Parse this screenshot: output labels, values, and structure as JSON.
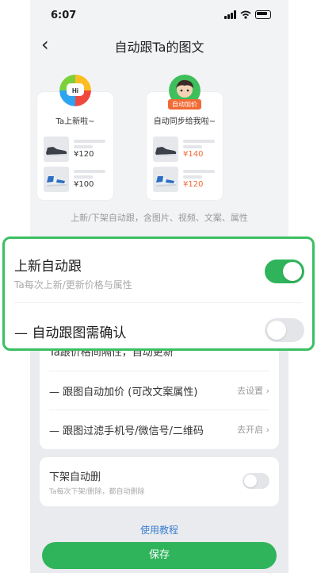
{
  "statusbar": {
    "time": "6:07"
  },
  "header": {
    "title": "自动跟Ta的图文",
    "back_label": "‹"
  },
  "preview": {
    "left_card": {
      "title": "Ta上新啦~",
      "items": [
        {
          "price": "¥120"
        },
        {
          "price": "¥100"
        }
      ]
    },
    "right_card": {
      "title": "自动同步给我啦~",
      "badge": "自动加价",
      "items": [
        {
          "price": "¥140"
        },
        {
          "price": "¥120"
        }
      ]
    },
    "caption": "上新/下架自动跟，含图片、视频、文案、属性"
  },
  "highlight": {
    "auto_follow_new": {
      "label": "上新自动跟",
      "sublabel": "Ta每次上新/更新价格与属性",
      "enabled": true
    },
    "confirm_required": {
      "label": "— 自动跟图需确认",
      "enabled": false
    }
  },
  "settings": {
    "partial_row": {
      "label": "Ta跟价格间隔性，自动更新"
    },
    "markup": {
      "label": "— 跟图自动加价 (可改文案属性)",
      "action": "去设置 ›"
    },
    "filter": {
      "label": "— 跟图过滤手机号/微信号/二维码",
      "action": "去开启 ›"
    }
  },
  "delist": {
    "label": "下架自动删",
    "sublabel": "Ta每次下架/删除，都自动删除",
    "enabled": false
  },
  "footer": {
    "help_link": "使用教程",
    "save_button": "保存"
  },
  "colors": {
    "accent": "#2fb45b",
    "price_red": "#f26a35",
    "link": "#3a7fd0"
  }
}
